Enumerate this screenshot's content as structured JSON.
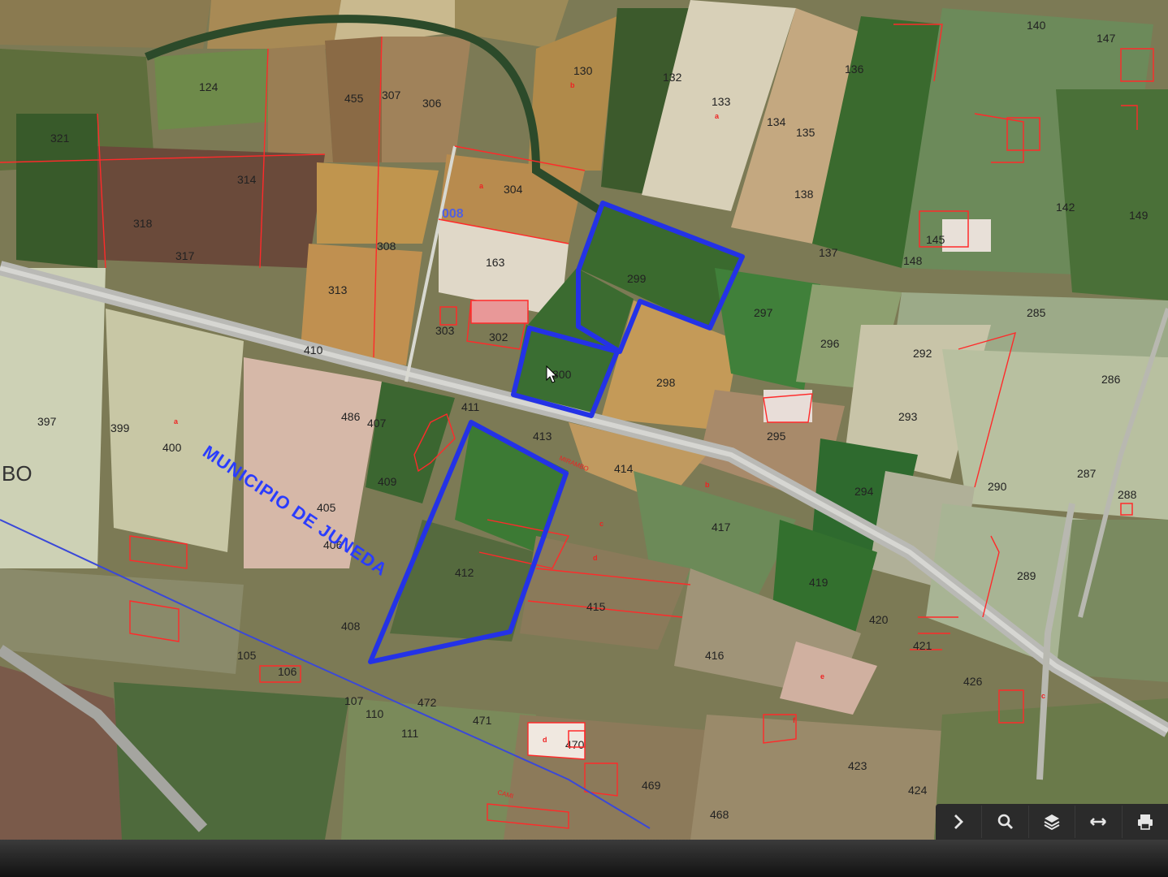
{
  "map": {
    "municipality_label": "MUNICIPIO DE JUNEDA",
    "place_label_left": "BO",
    "place_label_code": "008",
    "road_labels": [
      "MIRAMBO",
      "CAMI"
    ],
    "parcels": [
      "130",
      "132",
      "133",
      "134",
      "135",
      "136",
      "124",
      "455",
      "307",
      "306",
      "304",
      "321",
      "314",
      "318",
      "308",
      "317",
      "163",
      "313",
      "303",
      "302",
      "410",
      "411",
      "486",
      "407",
      "397",
      "399",
      "400",
      "409",
      "408",
      "406",
      "405",
      "299",
      "297",
      "296",
      "298",
      "300",
      "413",
      "414",
      "417",
      "292",
      "293",
      "295",
      "294",
      "290",
      "286",
      "287",
      "285",
      "288",
      "289",
      "419",
      "420",
      "421",
      "426",
      "423",
      "424",
      "412",
      "415",
      "416",
      "470",
      "469",
      "468",
      "471",
      "472",
      "110",
      "111",
      "105",
      "106",
      "107",
      "145",
      "147",
      "148",
      "149",
      "140",
      "137",
      "138",
      "142"
    ],
    "red_marks": [
      "a",
      "b",
      "c",
      "d",
      "e",
      "f"
    ],
    "colors": {
      "boundary": "#2432e6",
      "parcel_lines": "#ff2a2a",
      "road": "#b8b8b8"
    }
  },
  "toolbar": {
    "buttons": [
      {
        "name": "next-button",
        "icon": "chevron-right-icon"
      },
      {
        "name": "search-button",
        "icon": "search-icon"
      },
      {
        "name": "layers-button",
        "icon": "layers-icon"
      },
      {
        "name": "measure-button",
        "icon": "arrows-horizontal-icon"
      },
      {
        "name": "print-button",
        "icon": "print-icon"
      }
    ]
  }
}
